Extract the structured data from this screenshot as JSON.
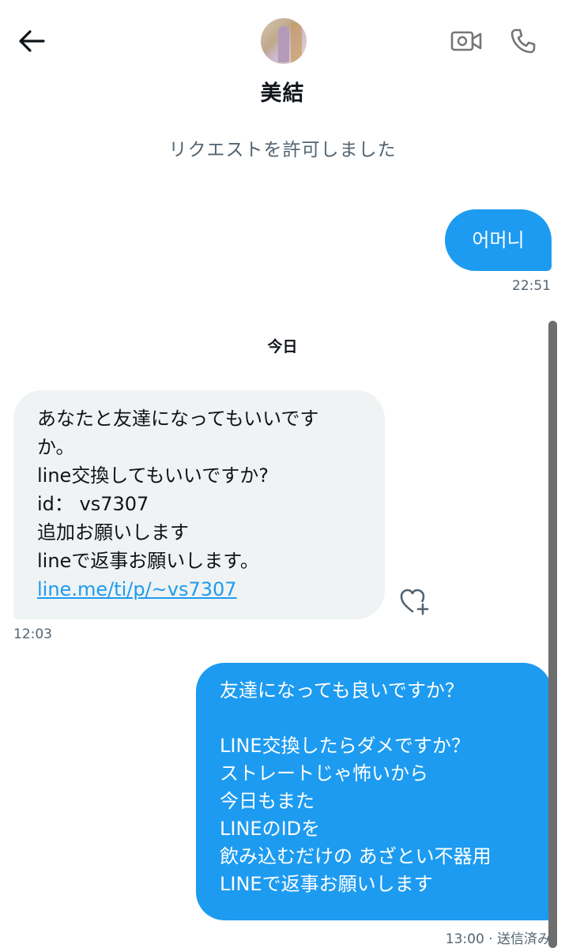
{
  "header": {
    "contact_name": "美結",
    "icons": {
      "back": "arrow-left-icon",
      "video": "video-camera-icon",
      "phone": "phone-icon"
    }
  },
  "conversation": {
    "request_note": "リクエストを許可しました",
    "messages": [
      {
        "direction": "outgoing",
        "lines": [
          "어머니"
        ],
        "time": "22:51"
      },
      {
        "date_separator": "今日"
      },
      {
        "direction": "incoming",
        "lines": [
          "あなたと友達になってもいいです",
          "か。",
          "line交換してもいいですか?",
          "id： vs7307",
          "追加お願いします",
          "lineで返事お願いします。"
        ],
        "link": "line.me/ti/p/~vs7307",
        "time": "12:03"
      },
      {
        "direction": "outgoing",
        "lines": [
          "友達になっても良いですか？",
          "",
          "LINE交換したらダメですか？",
          "ストレートじゃ怖いから",
          "今日もまた",
          "LINEのIDを",
          "飲み込むだけの あざとい不器用",
          "LINEで返事お願いします"
        ],
        "time": "13:00",
        "status": "送信済み"
      }
    ]
  },
  "colors": {
    "outgoing_bubble": "#1d9bf0",
    "incoming_bubble": "#eff3f4",
    "muted_text": "#536471"
  }
}
